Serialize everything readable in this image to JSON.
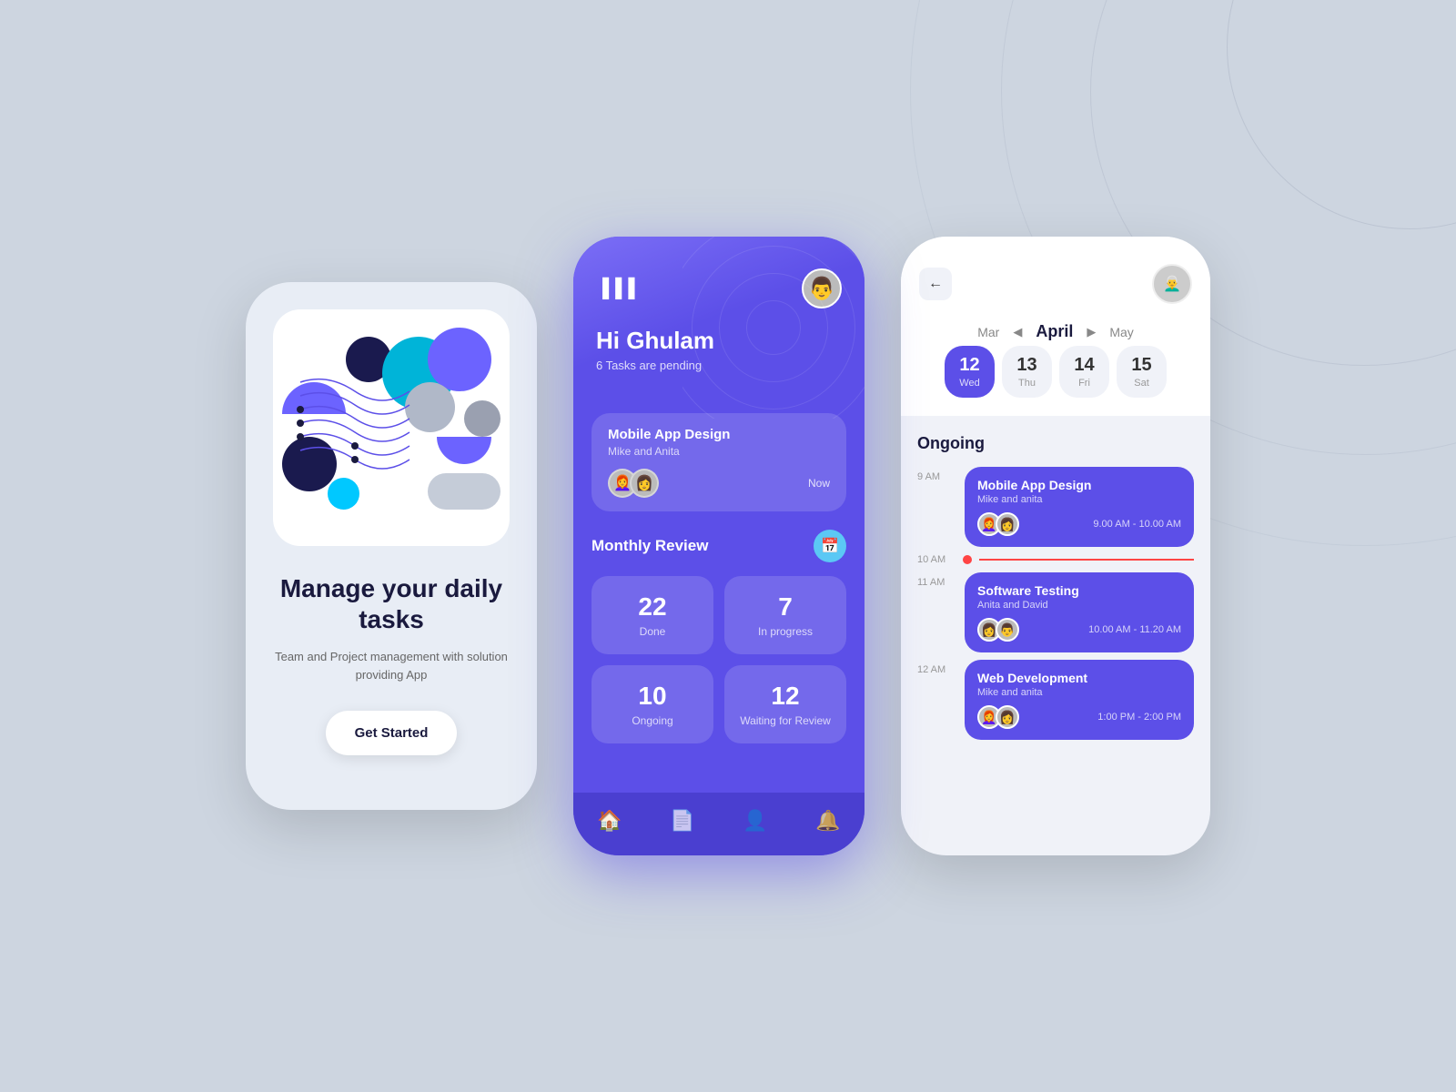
{
  "background": "#cdd5e0",
  "phone1": {
    "title": "Manage your daily tasks",
    "subtitle": "Team and Project management with solution providing App",
    "btn_label": "Get Started"
  },
  "phone2": {
    "greeting": "Hi Ghulam",
    "tasks_pending": "6 Tasks are pending",
    "task_card": {
      "title": "Mobile App Design",
      "sub": "Mike and Anita",
      "time": "Now"
    },
    "review": {
      "title": "Monthly Review",
      "stats": [
        {
          "num": "22",
          "label": "Done"
        },
        {
          "num": "7",
          "label": "In progress"
        },
        {
          "num": "10",
          "label": "Ongoing"
        },
        {
          "num": "12",
          "label": "Waiting for Review"
        }
      ]
    },
    "nav": [
      "🏠",
      "📄",
      "👤",
      "🔔"
    ]
  },
  "phone3": {
    "back_label": "←",
    "month": "April",
    "prev_month": "Mar",
    "next_month": "May",
    "dates": [
      {
        "num": "12",
        "day": "Wed",
        "active": true
      },
      {
        "num": "13",
        "day": "Thu",
        "active": false
      },
      {
        "num": "14",
        "day": "Fri",
        "active": false
      },
      {
        "num": "15",
        "day": "Sat",
        "active": false
      }
    ],
    "ongoing_title": "Ongoing",
    "events": [
      {
        "time": "9 AM",
        "title": "Mobile App Design",
        "sub": "Mike and anita",
        "time_range": "9.00 AM - 10.00 AM"
      },
      {
        "time": "10 AM",
        "is_progress": true
      },
      {
        "time": "11 AM",
        "title": "Software Testing",
        "sub": "Anita and David",
        "time_range": "10.00 AM - 11.20 AM"
      },
      {
        "time": "12 AM",
        "title": "Web Development",
        "sub": "Mike and anita",
        "time_range": "1:00 PM - 2:00 PM"
      }
    ],
    "time_labels": {
      "progress": "10 AM",
      "event3_time": "1:00 PM",
      "event3_label": "12 AM"
    }
  }
}
